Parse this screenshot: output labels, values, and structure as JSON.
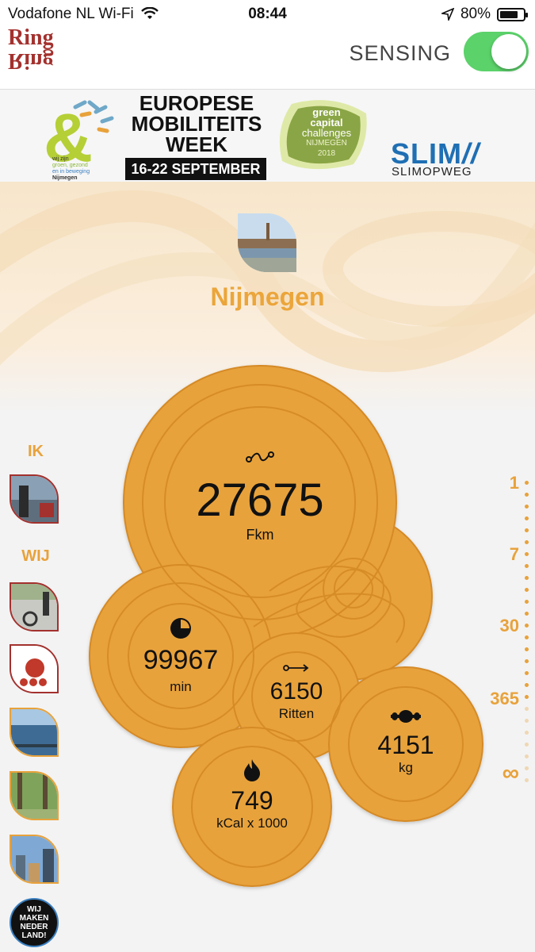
{
  "status_bar": {
    "carrier": "Vodafone NL Wi-Fi",
    "time": "08:44",
    "battery": "80%",
    "battery_level": 0.8
  },
  "app": {
    "logo_top": "Ring",
    "logo_bottom": "Ring",
    "sensing_label": "SENSING",
    "sensing_on": true
  },
  "banner": {
    "tagline_lines": [
      "wij zijn",
      "groen, gezond",
      "en in beweging",
      "Nijmegen"
    ],
    "event_title_lines": [
      "EUROPESE",
      "MOBILITEITS",
      "WEEK"
    ],
    "event_dates": "16-22 SEPTEMBER",
    "gcc_lines": [
      "green",
      "capital",
      "challenges",
      "NIJMEGEN",
      "2018"
    ],
    "slim_title": "SLIM",
    "slim_sub": "SLIMOPWEG"
  },
  "city": {
    "name": "Nijmegen"
  },
  "sidebar": {
    "ik_label": "IK",
    "wij_label": "WIJ",
    "badge_text": [
      "WIJ",
      "MAKEN",
      "NEDER",
      "LAND!"
    ]
  },
  "stats": {
    "distance": {
      "value": "27675",
      "unit": "Fkm",
      "icon": "route-icon"
    },
    "time": {
      "value": "99967",
      "unit": "min",
      "icon": "clock-icon"
    },
    "trips": {
      "value": "6150",
      "unit": "Ritten",
      "icon": "arrow-icon"
    },
    "co2": {
      "value": "4151",
      "unit": "kg",
      "icon": "weight-icon"
    },
    "calories": {
      "value": "749",
      "unit": "kCal x 1000",
      "icon": "flame-icon"
    }
  },
  "period_scale": {
    "options": [
      "1",
      "7",
      "30",
      "365",
      "∞"
    ]
  },
  "colors": {
    "accent": "#E8A23B",
    "accent_dark": "#D9902A",
    "brand_red": "#A3312E",
    "toggle_green": "#5BD26A"
  }
}
